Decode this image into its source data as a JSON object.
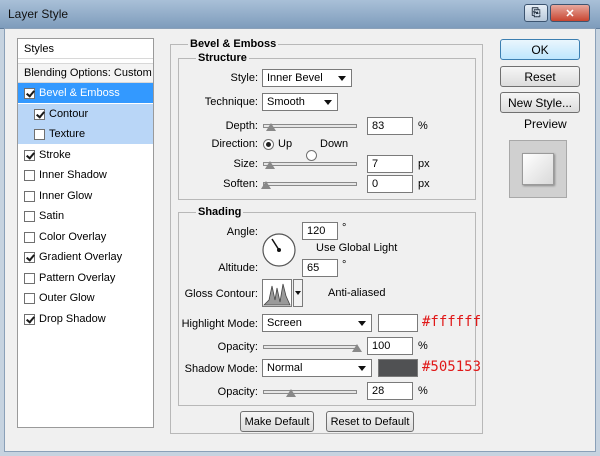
{
  "window": {
    "title": "Layer Style"
  },
  "sidebar": {
    "header": "Styles",
    "blending": "Blending Options: Custom",
    "items": [
      {
        "label": "Bevel & Emboss",
        "checked": true
      },
      {
        "label": "Contour",
        "checked": true
      },
      {
        "label": "Texture",
        "checked": false
      },
      {
        "label": "Stroke",
        "checked": true
      },
      {
        "label": "Inner Shadow",
        "checked": false
      },
      {
        "label": "Inner Glow",
        "checked": false
      },
      {
        "label": "Satin",
        "checked": false
      },
      {
        "label": "Color Overlay",
        "checked": false
      },
      {
        "label": "Gradient Overlay",
        "checked": true
      },
      {
        "label": "Pattern Overlay",
        "checked": false
      },
      {
        "label": "Outer Glow",
        "checked": false
      },
      {
        "label": "Drop Shadow",
        "checked": true
      }
    ]
  },
  "bevel": {
    "heading": "Bevel & Emboss",
    "structure": {
      "heading": "Structure",
      "style_label": "Style:",
      "style_value": "Inner Bevel",
      "technique_label": "Technique:",
      "technique_value": "Smooth",
      "depth_label": "Depth:",
      "depth_value": "83",
      "depth_unit": "%",
      "direction_label": "Direction:",
      "up_label": "Up",
      "down_label": "Down",
      "size_label": "Size:",
      "size_value": "7",
      "size_unit": "px",
      "soften_label": "Soften:",
      "soften_value": "0",
      "soften_unit": "px"
    },
    "shading": {
      "heading": "Shading",
      "angle_label": "Angle:",
      "angle_value": "120",
      "angle_unit": "°",
      "global_light_label": "Use Global Light",
      "altitude_label": "Altitude:",
      "altitude_value": "65",
      "altitude_unit": "°",
      "gloss_label": "Gloss Contour:",
      "antialiased_label": "Anti-aliased",
      "highlight_label": "Highlight Mode:",
      "highlight_value": "Screen",
      "highlight_color": "#ffffff",
      "highlight_annotation": "#ffffff",
      "hl_opacity_label": "Opacity:",
      "hl_opacity_value": "100",
      "hl_opacity_unit": "%",
      "shadow_label": "Shadow Mode:",
      "shadow_value": "Normal",
      "shadow_color": "#505153",
      "shadow_annotation": "#505153",
      "sh_opacity_label": "Opacity:",
      "sh_opacity_value": "28",
      "sh_opacity_unit": "%"
    },
    "make_default": "Make Default",
    "reset_default": "Reset to Default"
  },
  "actions": {
    "ok": "OK",
    "reset": "Reset",
    "new_style": "New Style...",
    "preview": "Preview"
  }
}
